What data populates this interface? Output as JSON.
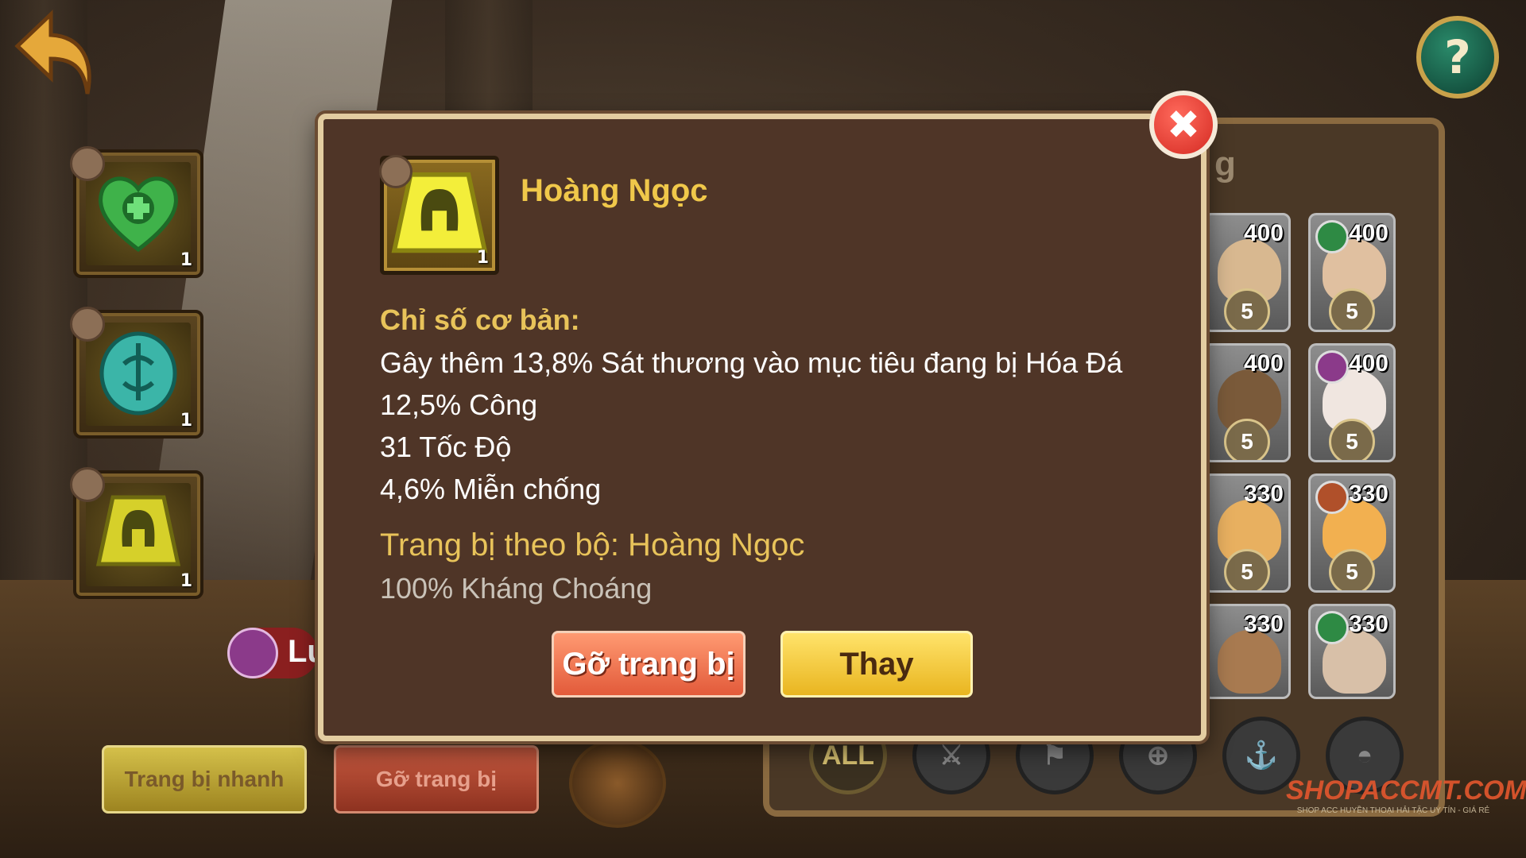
{
  "item": {
    "name": "Hoàng Ngọc",
    "count": "1",
    "base_stats_label": "Chỉ số cơ bản:",
    "stats": [
      "Gây thêm 13,8% Sát thương vào mục tiêu đang bị Hóa Đá",
      "12,5% Công",
      "31 Tốc Độ",
      "4,6% Miễn chống"
    ],
    "set_label": "Trang bị theo bộ: Hoàng Ngọc",
    "set_bonus": "100% Kháng Choáng"
  },
  "modal_buttons": {
    "unequip": "Gỡ trang bị",
    "replace": "Thay"
  },
  "slots": [
    {
      "icon": "green-heart-gem-icon",
      "count": "1"
    },
    {
      "icon": "teal-round-gem-icon",
      "count": "1"
    },
    {
      "icon": "yellow-helmet-gem-icon",
      "count": "1"
    }
  ],
  "bottom_buttons": {
    "quick_equip": "Trang bị nhanh",
    "unequip_all": "Gỡ trang bị"
  },
  "hero_name_partial": "Lu",
  "panel_title_partial": "g",
  "heroes": [
    {
      "level": "400",
      "stars": "5"
    },
    {
      "level": "400",
      "stars": "5"
    },
    {
      "level": "400",
      "stars": "5"
    },
    {
      "level": "400",
      "stars": "5"
    },
    {
      "level": "330",
      "stars": "5"
    },
    {
      "level": "330",
      "stars": "5"
    },
    {
      "level": "330",
      "stars": ""
    },
    {
      "level": "330",
      "stars": ""
    }
  ],
  "filters": [
    "ALL",
    "sword-icon",
    "flag-icon",
    "crosshair-icon",
    "anchor-icon",
    "helmet-icon"
  ],
  "watermark": {
    "brand": "SHOPACCMT.COM",
    "tagline": "SHOP ACC HUYỀN THOẠI HẢI TẶC UY TÍN - GIÁ RẺ"
  },
  "colors": {
    "modal_bg": "#4f3527",
    "gold_text": "#e8c35a",
    "unequip_btn": "#f07a55",
    "replace_btn": "#f5cb3a"
  }
}
